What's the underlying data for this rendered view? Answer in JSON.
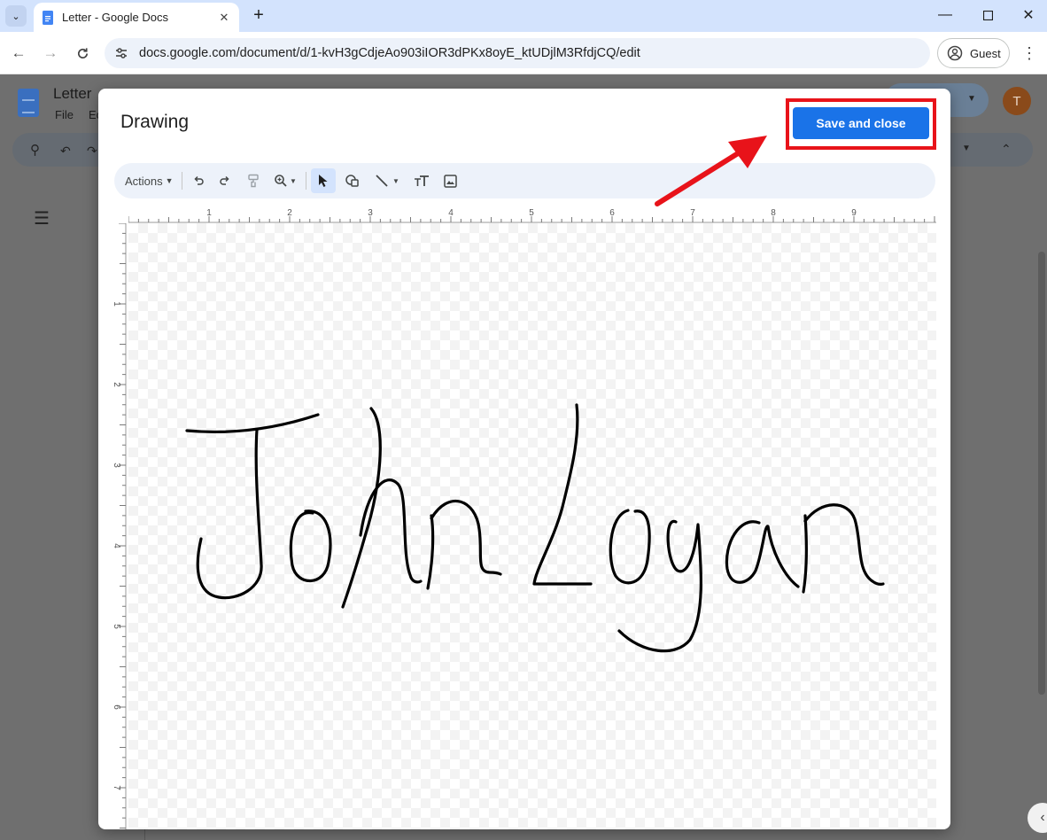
{
  "browser": {
    "tab_title": "Letter - Google Docs",
    "url": "docs.google.com/document/d/1-kvH3gCdjeAo903iIOR3dPKx8oyE_ktUDjlM3RfdjCQ/edit",
    "profile_label": "Guest"
  },
  "docs": {
    "doc_title": "Letter",
    "menu_file": "File",
    "menu_edit": "Ec",
    "avatar_letter": "T"
  },
  "dialog": {
    "title": "Drawing",
    "save_button": "Save and close",
    "toolbar": {
      "actions_label": "Actions",
      "tools": [
        "undo-icon",
        "redo-icon",
        "paint-format-icon",
        "zoom-icon",
        "select-icon",
        "shape-icon",
        "line-icon",
        "text-box-icon",
        "image-icon"
      ]
    },
    "ruler_h_labels": [
      "1",
      "2",
      "3",
      "4",
      "5",
      "6",
      "7",
      "8",
      "9"
    ],
    "ruler_v_labels": [
      "1",
      "2",
      "3",
      "4",
      "5",
      "6",
      "7"
    ],
    "canvas_content": "handwritten signature"
  },
  "colors": {
    "accent": "#1a73e8",
    "highlight": "#e8131a",
    "arrow": "#e8131a"
  }
}
